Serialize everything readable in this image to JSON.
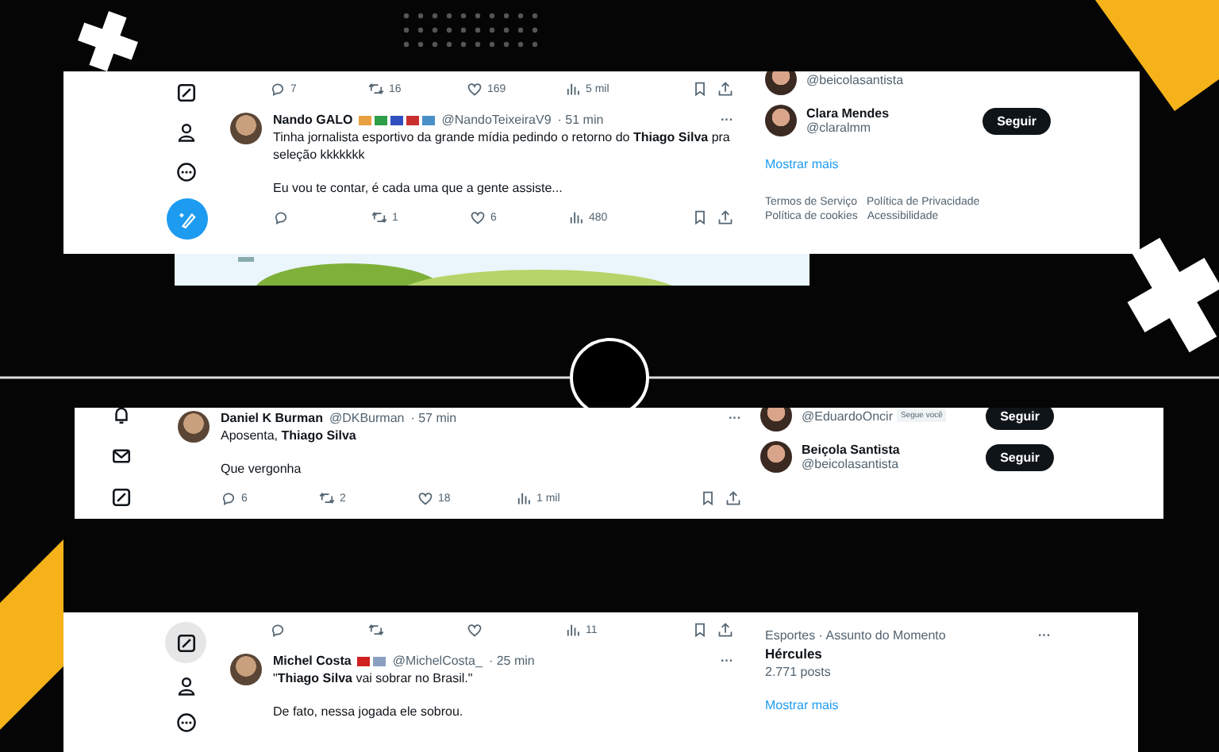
{
  "panels": [
    {
      "nav": [
        {
          "kind": "compose",
          "selected": false
        },
        {
          "kind": "profile",
          "selected": false
        },
        {
          "kind": "more",
          "selected": false
        },
        {
          "kind": "post",
          "selected": false
        }
      ],
      "stats_row": {
        "replies": "7",
        "reposts": "16",
        "likes": "169",
        "views": "5 mil"
      },
      "tweet": {
        "name": "Nando GALO",
        "badges": [
          {
            "color": "#e8a040"
          },
          {
            "color": "#2e9e48"
          },
          {
            "color": "#3050c0"
          },
          {
            "color": "#c83030"
          },
          {
            "color": "#4a90c8"
          }
        ],
        "handle": "@NandoTeixeiraV9",
        "time": "· 51 min",
        "more": "···",
        "paragraphs": [
          "Tinha jornalista esportivo da grande mídia pedindo o retorno do **Thiago Silva** pra seleção kkkkkkk",
          "Eu vou te contar, é cada uma que a gente assiste..."
        ],
        "stats": {
          "reposts": "1",
          "likes": "6",
          "views": "480"
        }
      },
      "sidebar": {
        "follows": [
          {
            "handle": "@beicolasantista"
          },
          {
            "name": "Clara Mendes",
            "handle": "@claralmm",
            "button": "Seguir"
          }
        ],
        "show_more": "Mostrar mais",
        "footer_links": [
          "Termos de Serviço",
          "Política de Privacidade",
          "Política de cookies",
          "Acessibilidade"
        ]
      }
    },
    {
      "nav": [
        {
          "kind": "notifications",
          "selected": false
        },
        {
          "kind": "messages",
          "selected": false
        },
        {
          "kind": "compose",
          "selected": false
        }
      ],
      "tweet": {
        "name": "Daniel K Burman",
        "handle": "@DKBurman",
        "time": "· 57 min",
        "more": "···",
        "paragraphs": [
          "Aposenta, **Thiago Silva**",
          "Que vergonha"
        ],
        "stats": {
          "replies": "6",
          "reposts": "2",
          "likes": "18",
          "views": "1 mil"
        }
      },
      "sidebar": {
        "follows": [
          {
            "handle": "@EduardoOncir",
            "follows_you": "Segue você",
            "button": "Seguir"
          },
          {
            "name": "Beiçola Santista",
            "handle": "@beicolasantista",
            "button": "Seguir"
          }
        ]
      }
    },
    {
      "nav": [
        {
          "kind": "compose",
          "selected": true
        },
        {
          "kind": "profile",
          "selected": false
        },
        {
          "kind": "more",
          "selected": false
        }
      ],
      "stats_row": {
        "views": "11"
      },
      "tweet": {
        "name": "Michel Costa",
        "badges": [
          {
            "color": "#d02020"
          },
          {
            "color": "#8aa0c0"
          }
        ],
        "handle": "@MichelCosta_",
        "time": "· 25 min",
        "more": "···",
        "paragraphs": [
          "\"**Thiago Silva** vai sobrar no Brasil.\"",
          "De fato, nessa jogada ele sobrou."
        ]
      },
      "sidebar": {
        "trend": {
          "context": "Esportes · Assunto do Momento",
          "title": "Hércules",
          "posts": "2.771 posts",
          "more": "···"
        },
        "show_more": "Mostrar mais"
      }
    }
  ]
}
